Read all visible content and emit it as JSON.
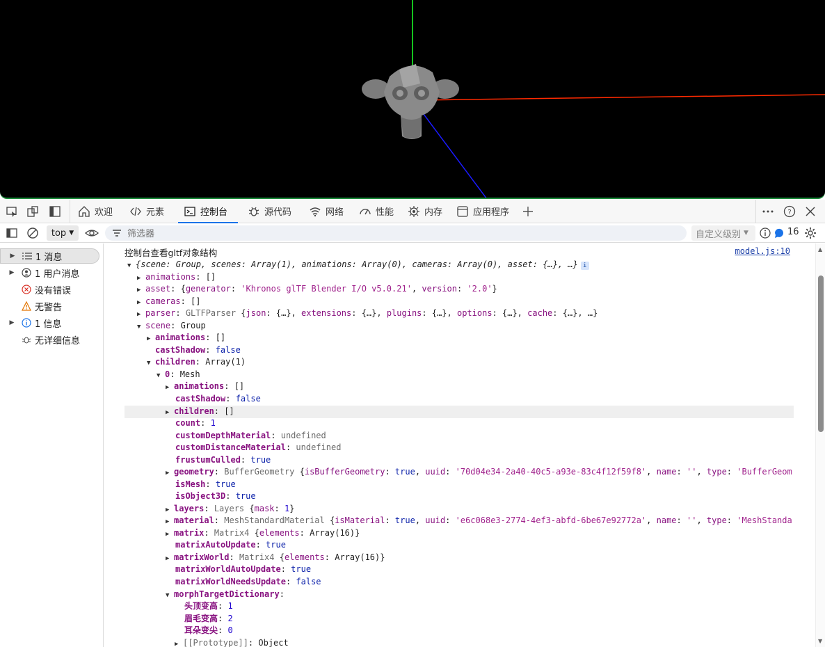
{
  "tabbar": {
    "tabs": [
      {
        "label": "欢迎",
        "icon": "home-icon"
      },
      {
        "label": "元素",
        "icon": "code-icon"
      },
      {
        "label": "控制台",
        "icon": "terminal-icon"
      },
      {
        "label": "源代码",
        "icon": "bug-icon"
      },
      {
        "label": "网络",
        "icon": "wifi-icon"
      },
      {
        "label": "性能",
        "icon": "speedometer-icon"
      },
      {
        "label": "内存",
        "icon": "chip-icon"
      },
      {
        "label": "应用程序",
        "icon": "window-icon"
      }
    ],
    "active_tab": "控制台"
  },
  "toolbar": {
    "context": "top",
    "filter_placeholder": "筛选器",
    "levels": "自定义级别",
    "issue_count": "16"
  },
  "sidebar": {
    "items": [
      {
        "label": "1 消息",
        "icon": "list-icon"
      },
      {
        "label": "1 用户消息",
        "icon": "user-icon"
      },
      {
        "label": "没有错误",
        "icon": "error-icon"
      },
      {
        "label": "无警告",
        "icon": "warning-icon"
      },
      {
        "label": "1 信息",
        "icon": "info-icon"
      },
      {
        "label": "无详细信息",
        "icon": "bug-icon"
      }
    ]
  },
  "console": {
    "title": "控制台查看gltf对象结构",
    "source": "model.js:10",
    "summary": "{scene: Group, scenes: Array(1), animations: Array(0), cameras: Array(0), asset: {…}, …}",
    "lines": {
      "animations_key": "animations",
      "animations_val": "[]",
      "asset_key": "asset",
      "asset_generator": "'Khronos glTF Blender I/O v5.0.21'",
      "asset_version": "'2.0'",
      "cameras_key": "cameras",
      "cameras_val": "[]",
      "parser_key": "parser",
      "parser_val": "GLTFParser",
      "scene_key": "scene",
      "scene_val": "Group",
      "castShadow_val": "false",
      "children_val": "Array(1)",
      "mesh_key": "0",
      "mesh_val": "Mesh",
      "count_val": "1",
      "undefined_val": "undefined",
      "true_val": "true",
      "geometry_uuid": "'70d04e34-2a40-40c5-a93e-83c4f12f59f8'",
      "material_uuid": "'e6c068e3-2774-4ef3-abfd-6be67e92772a'",
      "morph_1": "头顶变高",
      "morph_1_val": "1",
      "morph_2": "眉毛变高",
      "morph_2_val": "2",
      "morph_3": "耳朵变尖",
      "morph_3_val": "0"
    }
  },
  "colors": {
    "axis_x": "#ff2a00",
    "axis_y": "#14c31e",
    "axis_z": "#1a1aff",
    "active_tab_underline": "#1a73e8"
  }
}
